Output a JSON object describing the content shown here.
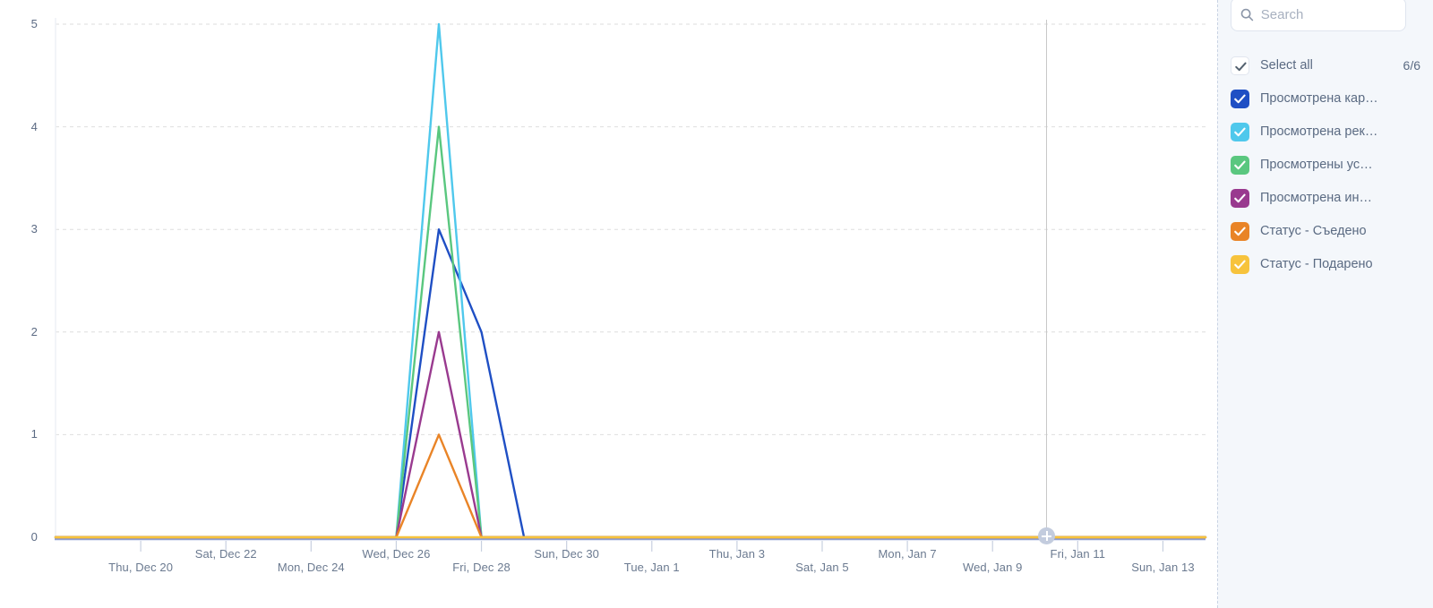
{
  "chart_data": {
    "type": "line",
    "title": "",
    "xlabel": "",
    "ylabel": "",
    "ylim": [
      0,
      5
    ],
    "yticks": [
      0,
      1,
      2,
      3,
      4,
      5
    ],
    "grid": true,
    "legend_position": "right",
    "x_tick_labels": [
      "Thu, Dec 20",
      "Sat, Dec 22",
      "Mon, Dec 24",
      "Wed, Dec 26",
      "Fri, Dec 28",
      "Sun, Dec 30",
      "Tue, Jan 1",
      "Thu, Jan 3",
      "Sat, Jan 5",
      "Mon, Jan 7",
      "Wed, Jan 9",
      "Fri, Jan 11",
      "Sun, Jan 13"
    ],
    "x": [
      "Dec 18",
      "Dec 19",
      "Dec 20",
      "Dec 21",
      "Dec 22",
      "Dec 23",
      "Dec 24",
      "Dec 25",
      "Dec 26",
      "Dec 27",
      "Dec 28",
      "Dec 29",
      "Dec 30",
      "Dec 31",
      "Jan 1",
      "Jan 2",
      "Jan 3",
      "Jan 4",
      "Jan 5",
      "Jan 6",
      "Jan 7",
      "Jan 8",
      "Jan 9",
      "Jan 10",
      "Jan 11",
      "Jan 12",
      "Jan 13",
      "Jan 14"
    ],
    "series": [
      {
        "name": "Просмотрена кар…",
        "color": "#1f4fc4",
        "peak_date": "Dec 27",
        "peak_value": 3,
        "values": [
          0,
          0,
          0,
          0,
          0,
          0,
          0,
          0,
          0,
          3,
          2,
          0,
          0,
          0,
          0,
          0,
          0,
          0,
          0,
          0,
          0,
          0,
          0,
          0,
          0,
          0,
          0,
          0
        ]
      },
      {
        "name": "Просмотрена рек…",
        "color": "#4fc8ec",
        "peak_date": "Dec 27",
        "peak_value": 5,
        "values": [
          0,
          0,
          0,
          0,
          0,
          0,
          0,
          0,
          0,
          5,
          0,
          0,
          0,
          0,
          0,
          0,
          0,
          0,
          0,
          0,
          0,
          0,
          0,
          0,
          0,
          0,
          0,
          0
        ]
      },
      {
        "name": "Просмотрены ус…",
        "color": "#5ac77f",
        "peak_date": "Dec 27",
        "peak_value": 4,
        "values": [
          0,
          0,
          0,
          0,
          0,
          0,
          0,
          0,
          0,
          4,
          0,
          0,
          0,
          0,
          0,
          0,
          0,
          0,
          0,
          0,
          0,
          0,
          0,
          0,
          0,
          0,
          0,
          0
        ]
      },
      {
        "name": "Просмотрена ин…",
        "color": "#993a8f",
        "peak_date": "Dec 27",
        "peak_value": 2,
        "values": [
          0,
          0,
          0,
          0,
          0,
          0,
          0,
          0,
          0,
          2,
          0,
          0,
          0,
          0,
          0,
          0,
          0,
          0,
          0,
          0,
          0,
          0,
          0,
          0,
          0,
          0,
          0,
          0
        ]
      },
      {
        "name": "Статус - Съедено",
        "color": "#e98427",
        "peak_date": "Dec 27",
        "peak_value": 1,
        "values": [
          0,
          0,
          0,
          0,
          0,
          0,
          0,
          0,
          0,
          1,
          0,
          0,
          0,
          0,
          0,
          0,
          0,
          0,
          0,
          0,
          0,
          0,
          0,
          0,
          0,
          0,
          0,
          0
        ]
      },
      {
        "name": "Статус - Подарено",
        "color": "#f7c33c",
        "peak_date": "Dec 27",
        "peak_value": 0,
        "values": [
          0,
          0,
          0,
          0,
          0,
          0,
          0,
          0,
          0,
          0,
          0,
          0,
          0,
          0,
          0,
          0,
          0,
          0,
          0,
          0,
          0,
          0,
          0,
          0,
          0,
          0,
          0,
          0
        ]
      }
    ]
  },
  "chart": {
    "axis_color": "#8e9fd4",
    "gridline_color": "#dedede",
    "cursor_line_color": "#c8c8c8",
    "add_handle_icon": "plus-circle-icon"
  },
  "legend": {
    "search": {
      "placeholder": "Search",
      "value": "",
      "icon": "search-icon"
    },
    "select_all": {
      "label": "Select all",
      "count": "6/6",
      "checked": true,
      "icon": "check-icon"
    },
    "items": [
      {
        "label": "Просмотрена кар…",
        "color": "#1f4fc4",
        "checked": true,
        "icon": "check-icon"
      },
      {
        "label": "Просмотрена рек…",
        "color": "#4fc8ec",
        "checked": true,
        "icon": "check-icon"
      },
      {
        "label": "Просмотрены ус…",
        "color": "#5ac77f",
        "checked": true,
        "icon": "check-icon"
      },
      {
        "label": "Просмотрена ин…",
        "color": "#993a8f",
        "checked": true,
        "icon": "check-icon"
      },
      {
        "label": "Статус - Съедено",
        "color": "#e98427",
        "checked": true,
        "icon": "check-icon"
      },
      {
        "label": "Статус - Подарено",
        "color": "#f7c33c",
        "checked": true,
        "icon": "check-icon"
      }
    ]
  }
}
